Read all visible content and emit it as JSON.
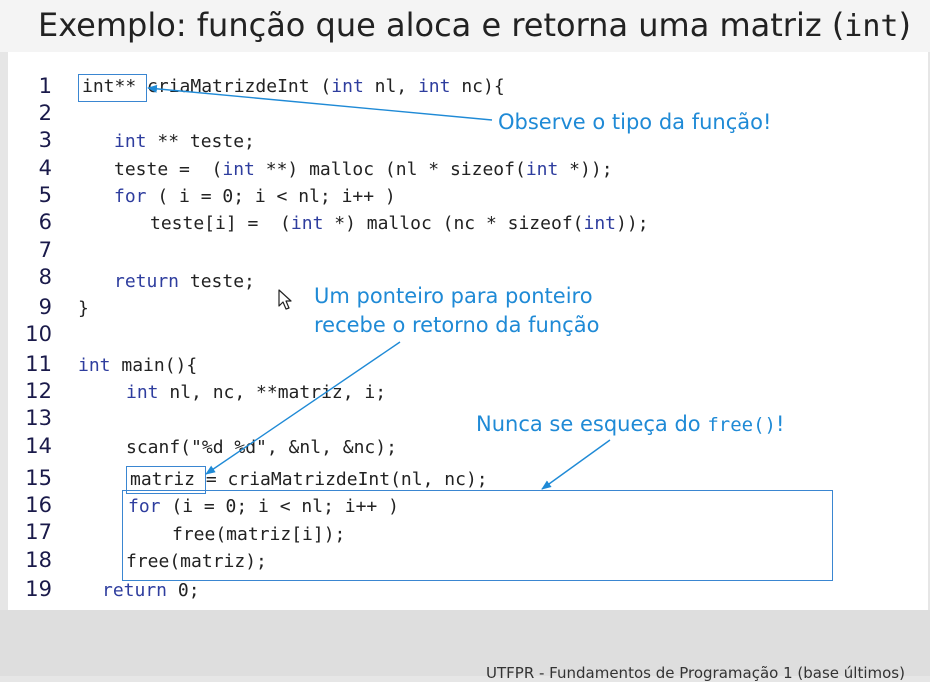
{
  "slide": {
    "title_text": "Exemplo: função que aloca e retorna uma matriz (",
    "title_code": "int",
    "title_close": ")",
    "footer": "UTFPR - Fundamentos de Programação 1 (base últimos)"
  },
  "code": {
    "line_numbers": [
      "1",
      "2",
      "3",
      "4",
      "5",
      "6",
      "7",
      "8",
      "9",
      "10",
      "11",
      "12",
      "13",
      "14",
      "15",
      "16",
      "17",
      "18",
      "19"
    ],
    "l1_kw": "int**",
    "l1_text": " criaMatrizdeInt (",
    "l1_kw2": "int",
    "l1_text2": " nl, ",
    "l1_kw3": "int",
    "l1_text3": " nc){",
    "l3_kw": "int",
    "l3_text": " ** teste;",
    "l4_text": "teste =  (",
    "l4_kw": "int",
    "l4_text2": " **) malloc (nl * sizeof(",
    "l4_kw2": "int",
    "l4_text3": " *));",
    "l5_kw": "for",
    "l5_text": " ( i = 0; i < nl; i++ )",
    "l6_text": "teste[i] =  (",
    "l6_kw": "int",
    "l6_text2": " *) malloc (nc * sizeof(",
    "l6_kw2": "int",
    "l6_text3": "));",
    "l8_kw": "return",
    "l8_text": " teste;",
    "l9_text": "}",
    "l11_kw": "int",
    "l11_text": " main(){",
    "l12_kw": "int",
    "l12_text": " nl, nc, **matriz, i;",
    "l14_text": "scanf(\"%d %d\", &nl, &nc);",
    "l15_var": "matriz",
    "l15_text": " = criaMatrizdeInt(nl, nc);",
    "l16_kw": "for",
    "l16_text": " (i = 0; i < nl; i++ )",
    "l17_text": "free(matriz[i]);",
    "l18_text": "free(matriz);",
    "l19_kw": "return",
    "l19_text": " 0;"
  },
  "annotations": {
    "note1": "Observe o tipo da função!",
    "note2_line1": "Um ponteiro para ponteiro",
    "note2_line2": "recebe o retorno da função",
    "note3_text": "Nunca se esqueça do ",
    "note3_code": "free()",
    "note3_end": "!"
  },
  "colors": {
    "annotation": "#1f8ad6",
    "keyword": "#2e3d9e",
    "box": "#3a86d1"
  }
}
